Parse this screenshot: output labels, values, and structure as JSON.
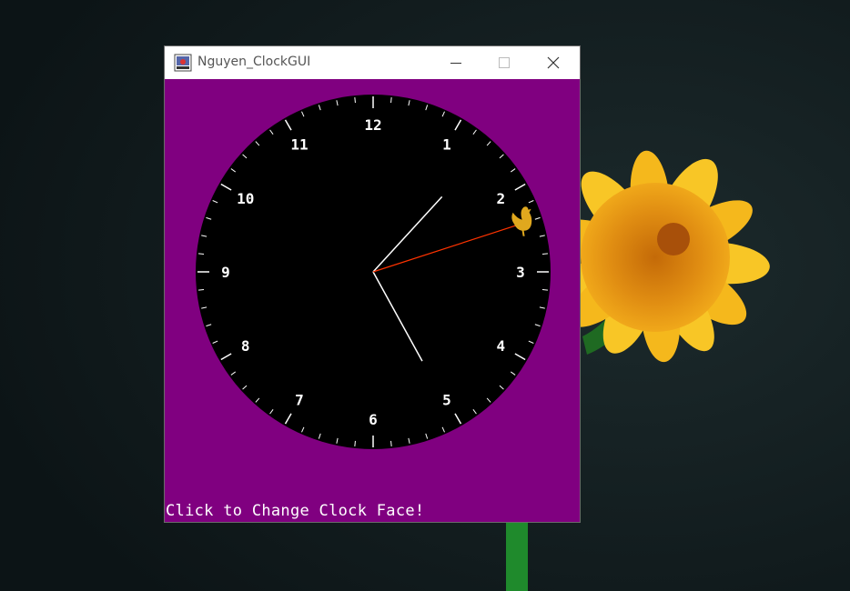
{
  "window": {
    "title": "Nguyen_ClockGUI",
    "icon": "java-app-icon",
    "controls": [
      "minimize-icon",
      "maximize-icon",
      "close-icon"
    ]
  },
  "clock": {
    "numerals": [
      "12",
      "1",
      "2",
      "3",
      "4",
      "5",
      "6",
      "7",
      "8",
      "9",
      "10",
      "11"
    ],
    "time": {
      "hour": 1,
      "minute": 25,
      "second": 12
    },
    "mascot_icon": "rooster-icon",
    "colors": {
      "background": "#800080",
      "face": "#000000",
      "ticks": "#ffffff",
      "numerals": "#ffffff",
      "hour_minute_hands": "#ffffff",
      "second_hand": "#ff3300",
      "mascot": "#e0a81e"
    }
  },
  "footer": {
    "hint": "Click to Change Clock Face!"
  },
  "desktop": {
    "wallpaper": "yellow-flower-on-dark-background"
  }
}
